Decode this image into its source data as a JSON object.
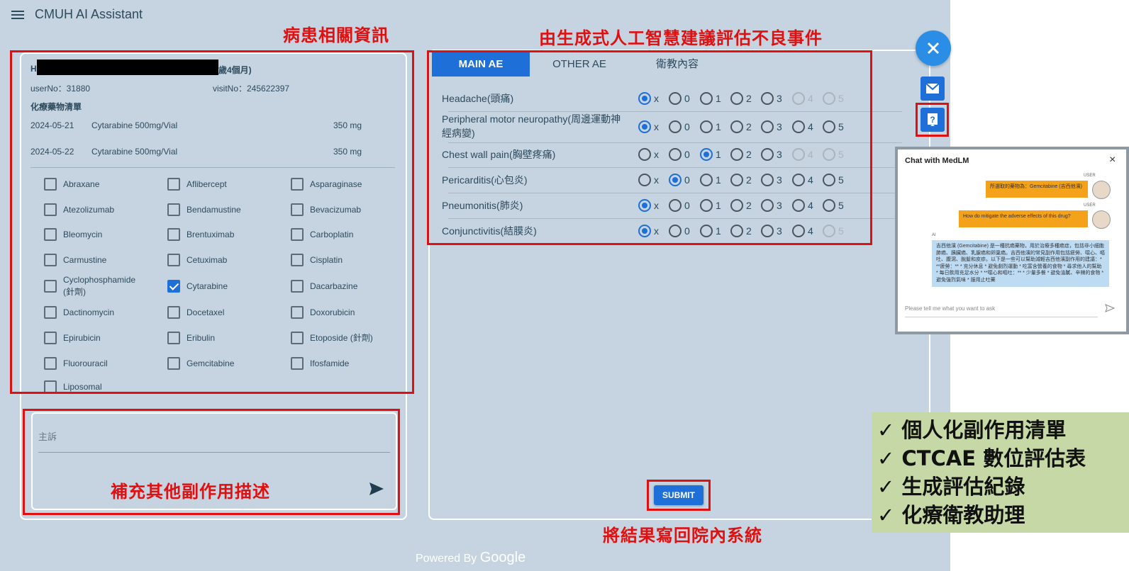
{
  "app": {
    "title": "CMUH AI Assistant",
    "powered_by": "Powered By",
    "powered_brand": "Google"
  },
  "annotations": {
    "patient_info": "病患相關資訊",
    "genai_ae": "由生成式人工智慧建議評估不良事件",
    "supplement": "補充其他副作用描述",
    "writeback": "將結果寫回院內系統"
  },
  "patient": {
    "name_prefix": "H",
    "age_suffix": "歲4個月)",
    "user_no": "userNo：31880",
    "visit_no": "visitNo：245622397",
    "med_list_title": "化療藥物清單",
    "orders": [
      {
        "date": "2024-05-21",
        "drug": "Cytarabine 500mg/Vial",
        "dose": "350 mg"
      },
      {
        "date": "2024-05-22",
        "drug": "Cytarabine 500mg/Vial",
        "dose": "350 mg"
      }
    ]
  },
  "drugs": [
    {
      "label": "Abraxane",
      "checked": false
    },
    {
      "label": "Aflibercept",
      "checked": false
    },
    {
      "label": "Asparaginase",
      "checked": false
    },
    {
      "label": "Atezolizumab",
      "checked": false
    },
    {
      "label": "Bendamustine",
      "checked": false
    },
    {
      "label": "Bevacizumab",
      "checked": false
    },
    {
      "label": "Bleomycin",
      "checked": false
    },
    {
      "label": "Brentuximab",
      "checked": false
    },
    {
      "label": "Carboplatin",
      "checked": false
    },
    {
      "label": "Carmustine",
      "checked": false
    },
    {
      "label": "Cetuximab",
      "checked": false
    },
    {
      "label": "Cisplatin",
      "checked": false
    },
    {
      "label": "Cyclophosphamide (針劑)",
      "checked": false
    },
    {
      "label": "Cytarabine",
      "checked": true
    },
    {
      "label": "Dacarbazine",
      "checked": false
    },
    {
      "label": "Dactinomycin",
      "checked": false
    },
    {
      "label": "Docetaxel",
      "checked": false
    },
    {
      "label": "Doxorubicin",
      "checked": false
    },
    {
      "label": "Epirubicin",
      "checked": false
    },
    {
      "label": "Eribulin",
      "checked": false
    },
    {
      "label": "Etoposide (針劑)",
      "checked": false
    },
    {
      "label": "Fluorouracil",
      "checked": false
    },
    {
      "label": "Gemcitabine",
      "checked": false
    },
    {
      "label": "Ifosfamide",
      "checked": false
    },
    {
      "label": "Liposomal",
      "checked": false
    }
  ],
  "complaint": {
    "placeholder": "主訴"
  },
  "tabs": [
    {
      "label": "MAIN AE",
      "active": true
    },
    {
      "label": "OTHER AE",
      "active": false
    },
    {
      "label": "衛教內容",
      "active": false
    }
  ],
  "grade_labels": [
    "x",
    "0",
    "1",
    "2",
    "3",
    "4",
    "5"
  ],
  "adverse_events": [
    {
      "name": "Headache(頭痛)",
      "selected": "x",
      "disabled": [
        "4",
        "5"
      ]
    },
    {
      "name": "Peripheral motor neuropathy(周邊運動神經病變)",
      "selected": "x",
      "disabled": []
    },
    {
      "name": "Chest wall pain(胸壁疼痛)",
      "selected": "1",
      "disabled": [
        "4",
        "5"
      ]
    },
    {
      "name": "Pericarditis(心包炎)",
      "selected": "0",
      "disabled": []
    },
    {
      "name": "Pneumonitis(肺炎)",
      "selected": "x",
      "disabled": []
    },
    {
      "name": "Conjunctivitis(結膜炎)",
      "selected": "x",
      "disabled": [
        "5"
      ]
    }
  ],
  "submit_label": "SUBMIT",
  "chat": {
    "title": "Chat with MedLM",
    "close": "×",
    "user_tag": "USER",
    "ai_tag": "AI",
    "messages": [
      {
        "role": "user",
        "text": "所選取的藥物為：Gemcitabine (吉西他濱)"
      },
      {
        "role": "user",
        "text": "How do mitigate the adverse effects of this drug?"
      },
      {
        "role": "ai",
        "text": "吉西他濱 (Gemcitabine) 是一種抗癌藥物，用於治療多種癌症，包括非小細胞肺癌、胰臟癌、乳腺癌和卵巢癌。吉西他濱的常見副作用包括疲勞、噁心、嘔吐、腹瀉、脫髮和皮疹。以下是一些可以幫助減輕吉西他濱副作用的建議：* **疲勞：** * 充分休息 * 避免劇烈運動 * 吃富含營養的食物 * 尋求他人的幫助 * 每日飲用充足水分 * **噁心和嘔吐：** * 少量多餐 * 避免油膩、辛辣的食物 * 避免強烈氣味 * 服用止吐藥"
      }
    ],
    "input_placeholder": "Please tell me what you want to ask"
  },
  "features": [
    "個人化副作用清單",
    "CTCAE 數位評估表",
    "生成評估紀錄",
    "化療衛教助理"
  ],
  "colors": {
    "accent": "#1e6fd8",
    "annotation_red": "#e01010",
    "background": "#c5d4e0",
    "feature_panel": "#c5d8a5"
  }
}
